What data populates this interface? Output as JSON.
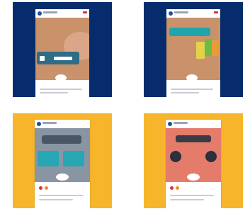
{
  "tiles": [
    {
      "variant": "blue",
      "photo": "tan"
    },
    {
      "variant": "blue",
      "photo": "tan"
    },
    {
      "variant": "yellow",
      "photo": "gray"
    },
    {
      "variant": "yellow",
      "photo": "salmon"
    }
  ],
  "colors": {
    "navy": "#062c6e",
    "yellow": "#f6b52a",
    "tan": "#c9926b",
    "teal": "#1fa5ac",
    "salmon": "#e57b6a"
  },
  "icons": [
    "avatar-icon",
    "menu-icon",
    "heart-icon",
    "comment-icon"
  ]
}
